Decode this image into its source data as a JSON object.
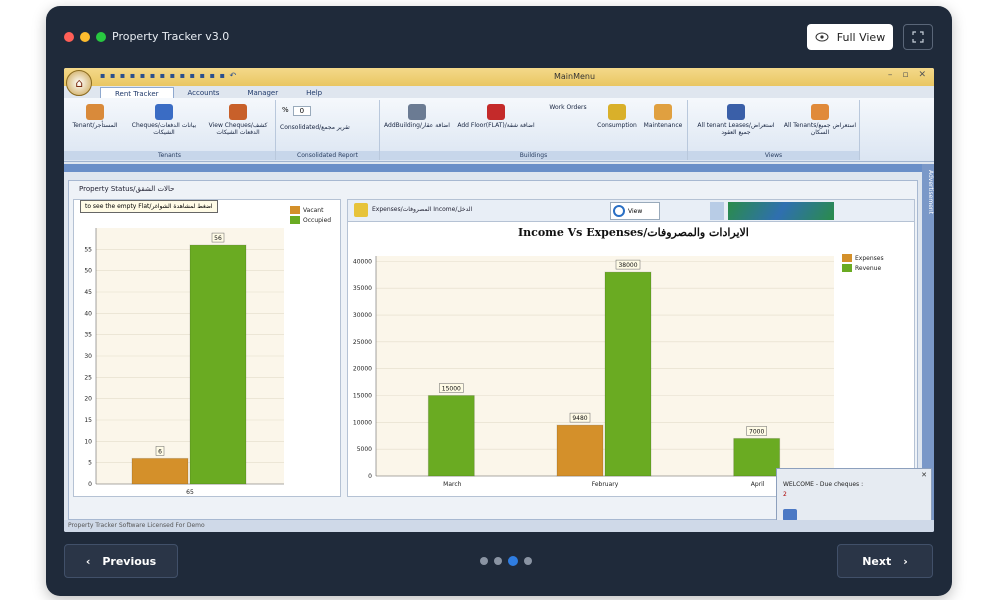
{
  "app": {
    "title": "Property Tracker v3.0",
    "full_view_label": "Full View",
    "window_colors": [
      "#ff5f57",
      "#febc2e",
      "#28c840"
    ]
  },
  "window": {
    "title": "MainMenu",
    "qat": "▪ ▪ ▪ ▪ ▪ ▪ ▪ ▪ ▪ ▪ ▪ ▪ ▪ ↶",
    "tabs": [
      "Rent Tracker",
      "Accounts",
      "Manager",
      "Help"
    ]
  },
  "ribbon": {
    "groups": [
      {
        "label": "Tenants",
        "buttons": [
          "Tenant/المستأجر",
          "Cheques/بيانات الدفعات الشيكات",
          "View Cheques/كشف الدفعات الشيكات"
        ]
      },
      {
        "label": "Consolidated Report",
        "buttons": [
          "Consolidated/تقرير مجمع"
        ],
        "spinner": {
          "prefix": "%",
          "value": "0"
        }
      },
      {
        "label": "Buildings",
        "buttons": [
          "AddBuilding/اضافة عقار",
          "Add Floor(FLAT)/اضافة شقة",
          "Work Orders",
          "Consumption",
          "Maintenance"
        ]
      },
      {
        "label": "Views",
        "buttons": [
          "All tenant Leases/استعراض جميع العقود",
          "All Tenants/استعراض جميع السكان"
        ]
      }
    ]
  },
  "side_tab": "Advertisement",
  "panel": {
    "title": "Property Status/حالات الشقق"
  },
  "left_chart": {
    "tooltip": "to see the empty Flat/اضغط لمشاهدة الشواغر",
    "legend": [
      {
        "label": "Vacant",
        "color": "#d4902a"
      },
      {
        "label": "Occupied",
        "color": "#6aab22"
      }
    ]
  },
  "right_chart": {
    "header_label": "Expenses/المصروفات Income/الدخل",
    "view_label": "View",
    "legend": [
      {
        "label": "Expenses",
        "color": "#d4902a"
      },
      {
        "label": "Revenue",
        "color": "#6aab22"
      }
    ]
  },
  "welcome": {
    "text": "WELCOME - Due cheques :",
    "count": "2"
  },
  "statusbar": "Property Tracker Software Licensed For Demo",
  "nav": {
    "previous": "Previous",
    "next": "Next",
    "page_count": 4,
    "active_page": 3
  },
  "chart_data": [
    {
      "type": "bar",
      "title": "",
      "categories": [
        "65"
      ],
      "series": [
        {
          "name": "Vacant",
          "values": [
            6
          ]
        },
        {
          "name": "Occupied",
          "values": [
            56
          ]
        }
      ],
      "yticks": [
        0,
        5,
        10,
        15,
        20,
        25,
        30,
        35,
        40,
        45,
        50,
        55
      ],
      "ylim": [
        0,
        60
      ],
      "data_labels": true,
      "legend": "top-right",
      "grid": true
    },
    {
      "type": "bar",
      "title": "Income Vs Expenses/الايرادات والمصروفات",
      "categories": [
        "March",
        "February",
        "April"
      ],
      "series": [
        {
          "name": "Expenses",
          "values": [
            null,
            9480,
            null
          ]
        },
        {
          "name": "Revenue",
          "values": [
            15000,
            38000,
            7000
          ]
        }
      ],
      "yticks": [
        0,
        5000,
        10000,
        15000,
        20000,
        25000,
        30000,
        35000,
        40000
      ],
      "ylim": [
        0,
        41000
      ],
      "data_labels": true,
      "legend": "top-right",
      "grid": true
    }
  ]
}
